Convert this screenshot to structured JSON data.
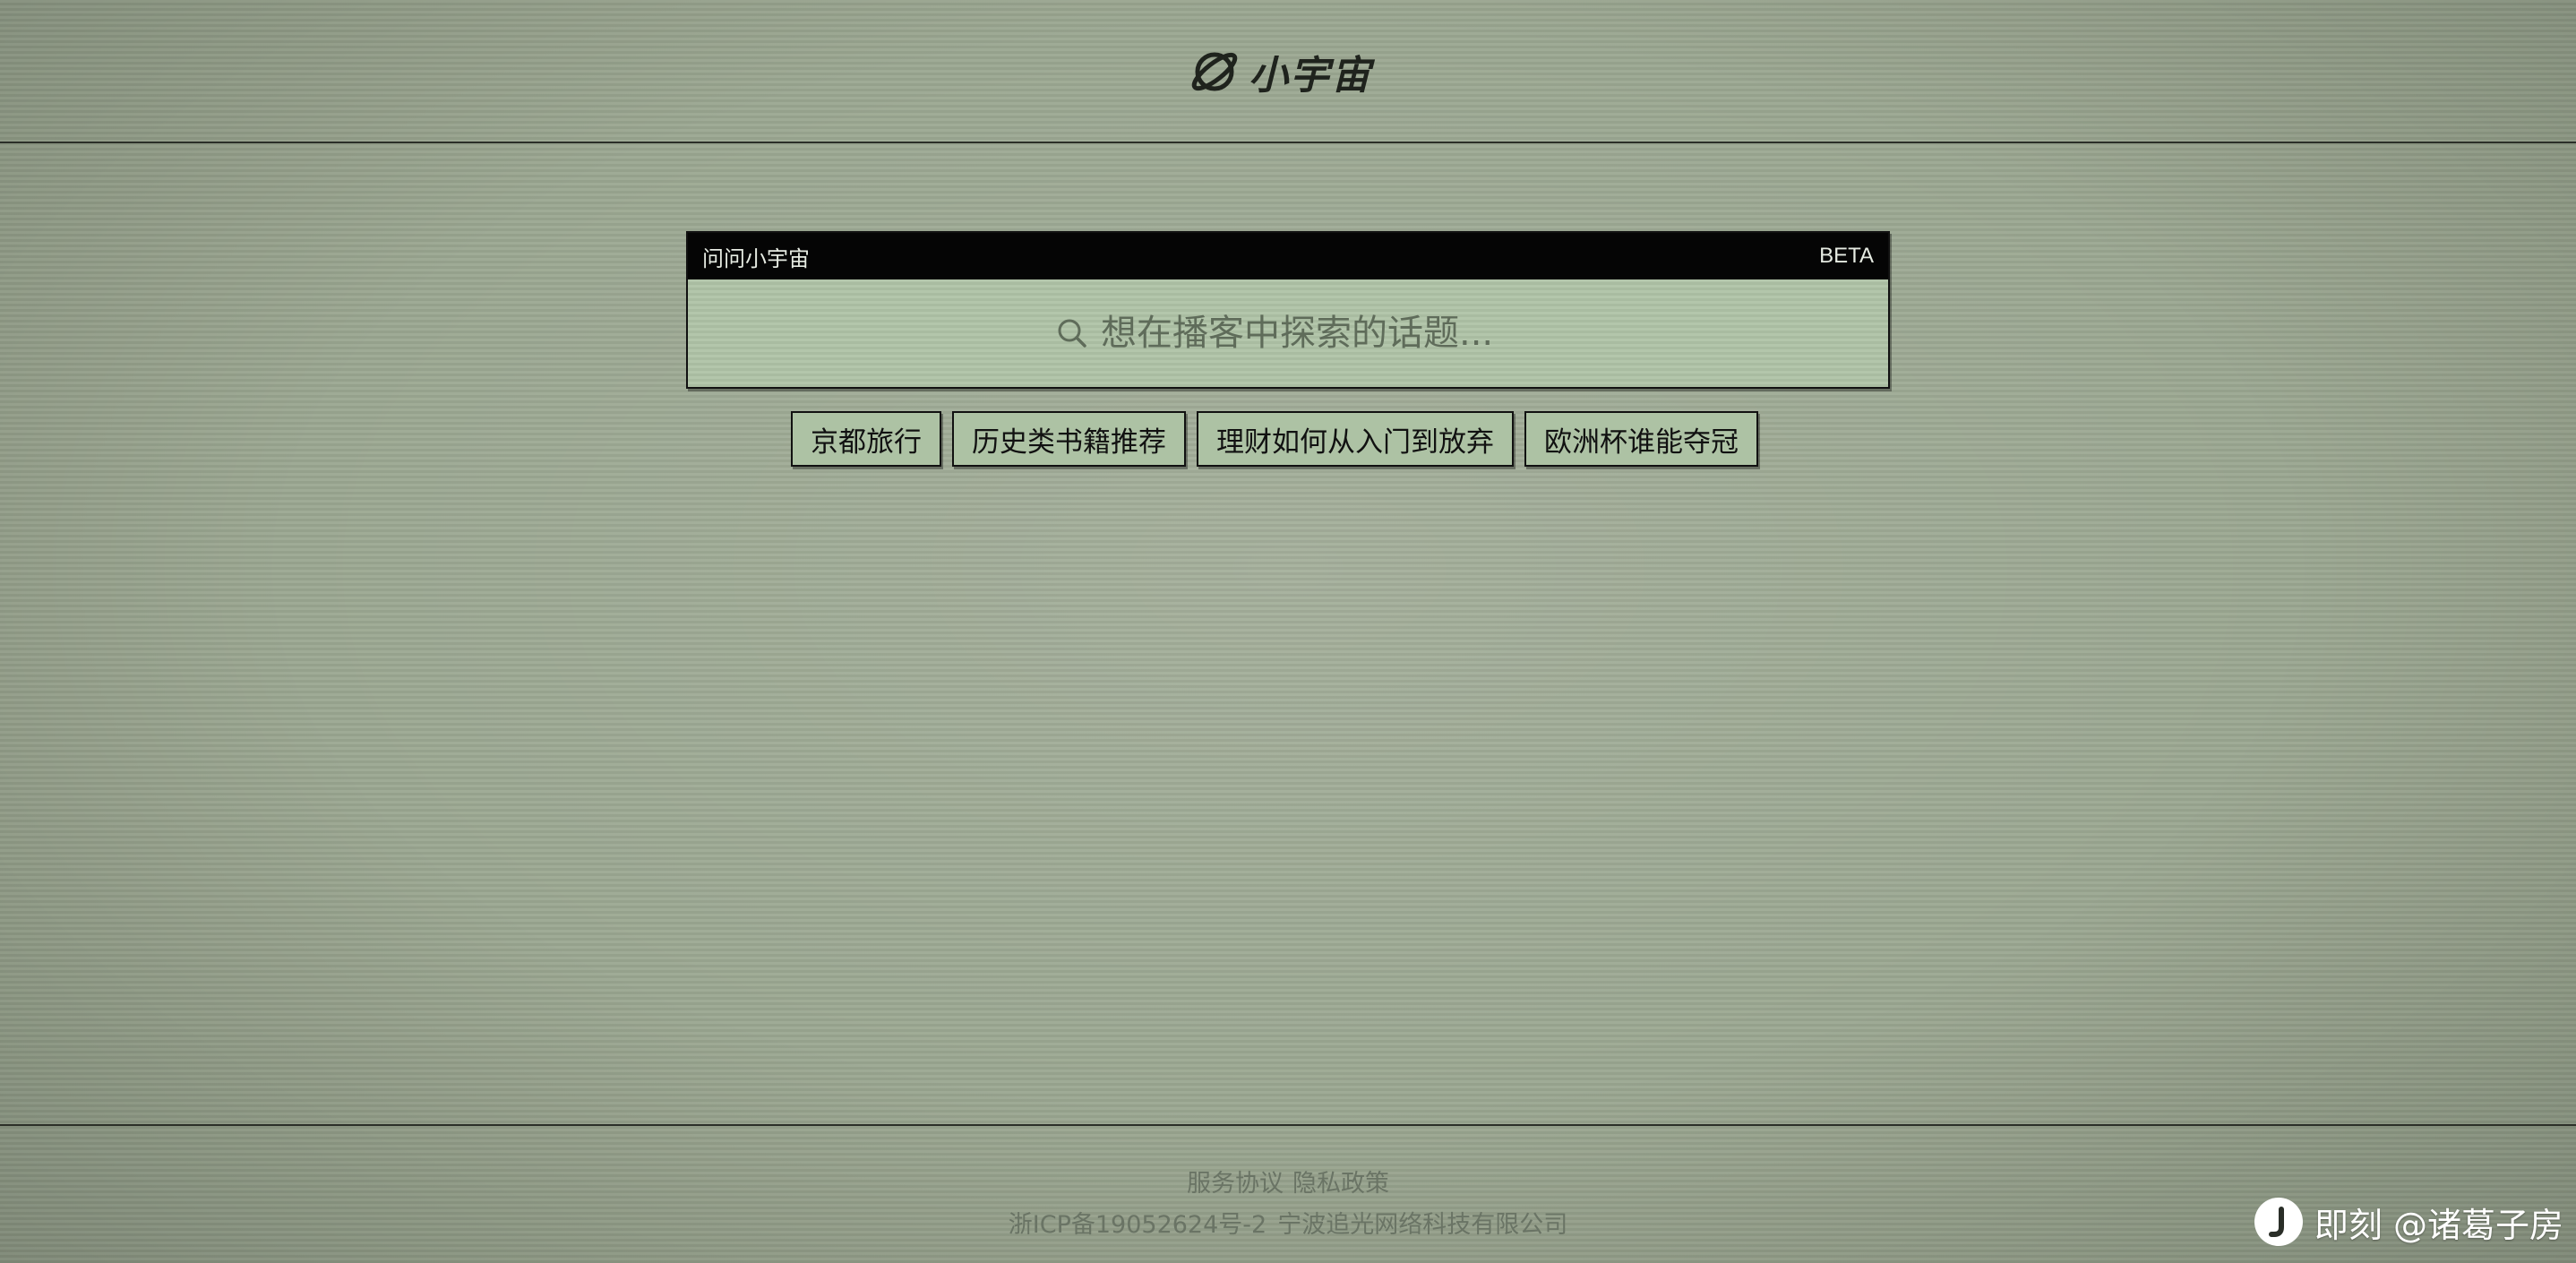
{
  "header": {
    "brand": "小宇宙",
    "logo_icon": "planet-icon"
  },
  "search_card": {
    "title": "问问小宇宙",
    "badge": "BETA",
    "placeholder": "想在播客中探索的话题...",
    "value": "",
    "icon": "search-icon"
  },
  "suggestions": [
    {
      "label": "京都旅行"
    },
    {
      "label": "历史类书籍推荐"
    },
    {
      "label": "理财如何从入门到放弃"
    },
    {
      "label": "欧洲杯谁能夺冠"
    }
  ],
  "footer": {
    "links": {
      "terms": "服务协议",
      "privacy": "隐私政策"
    },
    "icp": "浙ICP备19052624号-2",
    "company": "宁波追光网络科技有限公司"
  },
  "watermark": {
    "text": "即刻 @诸葛子房",
    "icon": "jike-logo-icon"
  },
  "colors": {
    "background": "#9ca892",
    "search_field": "#aec2a6",
    "bar": "#050505"
  }
}
